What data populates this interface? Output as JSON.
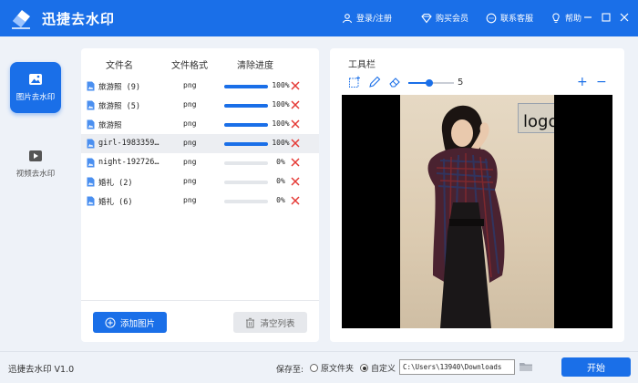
{
  "app": {
    "title": "迅捷去水印"
  },
  "topbar": {
    "login": "登录/注册",
    "buy": "购买会员",
    "support": "联系客服",
    "help": "帮助"
  },
  "nav": {
    "image_label": "图片去水印",
    "video_label": "视频去水印"
  },
  "file_list": {
    "headers": {
      "name": "文件名",
      "format": "文件格式",
      "progress": "清除进度"
    },
    "rows": [
      {
        "name": "旅游照 (9)",
        "format": "png",
        "progress": 100,
        "progress_label": "100%",
        "selected": false
      },
      {
        "name": "旅游照 (5)",
        "format": "png",
        "progress": 100,
        "progress_label": "100%",
        "selected": false
      },
      {
        "name": "旅游照",
        "format": "png",
        "progress": 100,
        "progress_label": "100%",
        "selected": false
      },
      {
        "name": "girl-1983359…",
        "format": "png",
        "progress": 100,
        "progress_label": "100%",
        "selected": true
      },
      {
        "name": "night-192726…",
        "format": "png",
        "progress": 0,
        "progress_label": "0%",
        "selected": false
      },
      {
        "name": "婚礼 (2)",
        "format": "png",
        "progress": 0,
        "progress_label": "0%",
        "selected": false
      },
      {
        "name": "婚礼 (6)",
        "format": "png",
        "progress": 0,
        "progress_label": "0%",
        "selected": false
      }
    ],
    "add_button": "添加图片",
    "clear_button": "清空列表"
  },
  "toolbar": {
    "title": "工具栏",
    "brush_size": "5",
    "brush_fraction": 0.45,
    "zoom_in": "+",
    "zoom_out": "−"
  },
  "preview": {
    "watermark_text": "logo 水印"
  },
  "statusbar": {
    "version": "迅捷去水印 V1.0",
    "save_to": "保存至:",
    "option_original": "原文件夹",
    "option_custom": "自定义",
    "selected_option": "custom",
    "path": "C:\\Users\\13940\\Downloads",
    "start_button": "开始"
  },
  "colors": {
    "accent": "#1a6fe8",
    "delete": "#e53935",
    "background": "#eef2f8"
  }
}
